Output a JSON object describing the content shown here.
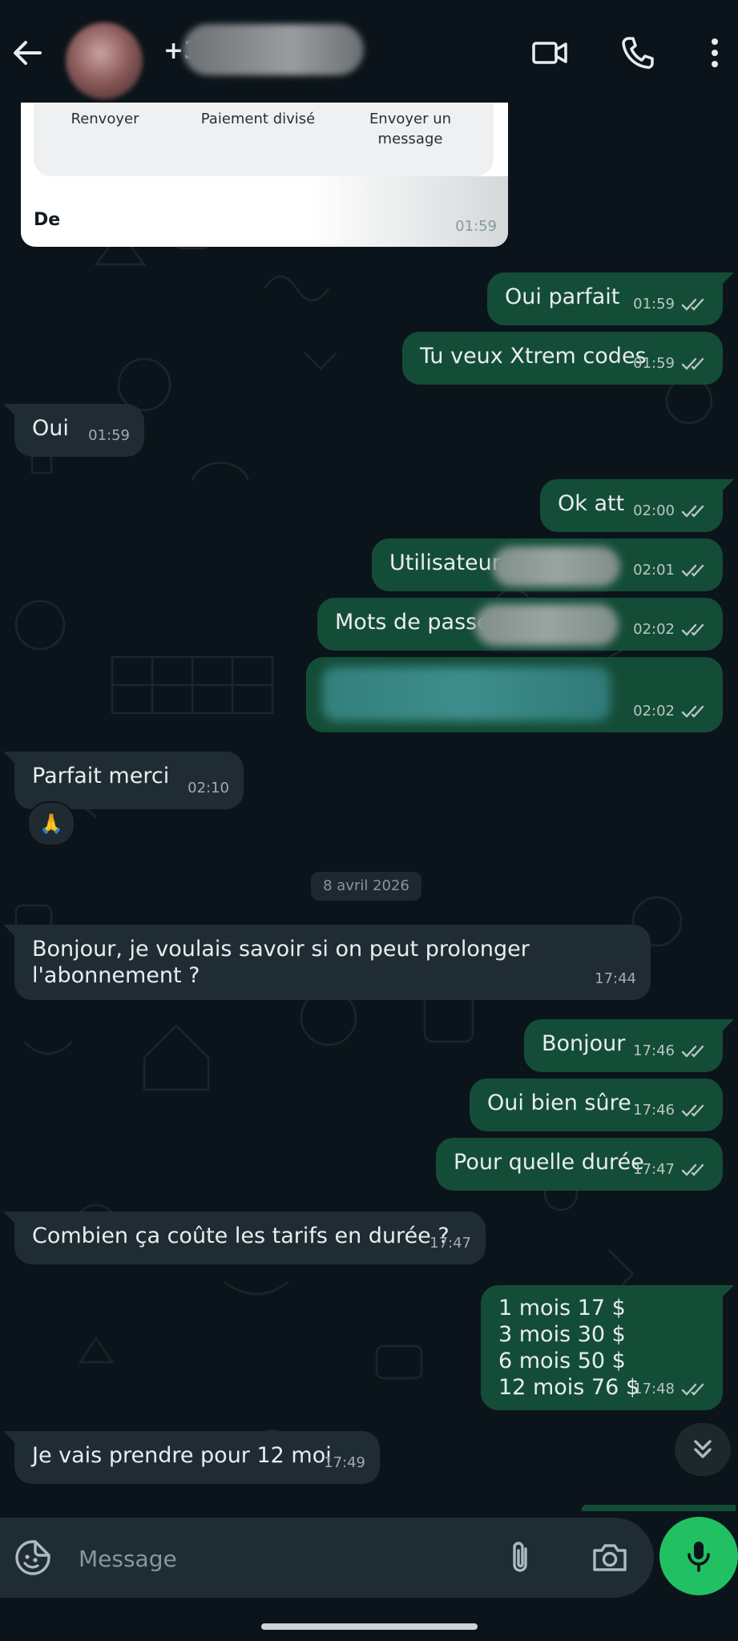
{
  "header": {
    "contact_prefix": "+3",
    "icons": [
      "back-arrow-icon",
      "video-call-icon",
      "phone-call-icon",
      "more-options-icon"
    ]
  },
  "top_card": {
    "actions": [
      "Renvoyer",
      "Paiement divisé",
      "Envoyer un\nmessage"
    ],
    "from": "De",
    "time": "01:59"
  },
  "messages": [
    {
      "dir": "out",
      "text": "Oui parfait",
      "time": "01:59",
      "read": true
    },
    {
      "dir": "out",
      "text": "Tu veux Xtrem codes",
      "time": "01:59",
      "read": true
    },
    {
      "dir": "in",
      "text": "Oui",
      "time": "01:59"
    },
    {
      "dir": "out",
      "text": "Ok att",
      "time": "02:00",
      "read": true
    },
    {
      "dir": "out",
      "text": "Utilisateur",
      "time": "02:01",
      "read": true
    },
    {
      "dir": "out",
      "text": "Mots de passe",
      "time": "02:02",
      "read": true
    },
    {
      "dir": "out",
      "text": "",
      "time": "02:02",
      "read": true
    },
    {
      "dir": "in",
      "text": "Parfait merci",
      "time": "02:10",
      "reaction": "🙏"
    },
    {
      "dir": "in",
      "text": "Bonjour, je voulais savoir si on peut prolonger\nl'abonnement ?",
      "time": "17:44"
    },
    {
      "dir": "out",
      "text": "Bonjour",
      "time": "17:46",
      "read": true
    },
    {
      "dir": "out",
      "text": "Oui bien sûre",
      "time": "17:46",
      "read": true
    },
    {
      "dir": "out",
      "text": "Pour quelle durée",
      "time": "17:47",
      "read": true
    },
    {
      "dir": "in",
      "text": "Combien ça coûte les tarifs en durée ?",
      "time": "17:47"
    },
    {
      "dir": "out",
      "text": "1 mois 17 $\n3 mois 30 $\n6 mois 50 $\n12 mois 76 $",
      "time": "17:48",
      "read": true
    },
    {
      "dir": "in",
      "text": "Je vais prendre pour 12 moi",
      "time": "17:49"
    }
  ],
  "date_separator": "8 avril 2026",
  "composer": {
    "placeholder": "Message",
    "icons": [
      "sticker-icon",
      "attach-icon",
      "camera-icon",
      "microphone-icon"
    ]
  },
  "colors": {
    "background": "#0b141a",
    "outgoing_bubble": "#144d37",
    "incoming_bubble": "#202c33",
    "read_ticks": "#b9c6c1",
    "mic_button": "#21c063"
  }
}
